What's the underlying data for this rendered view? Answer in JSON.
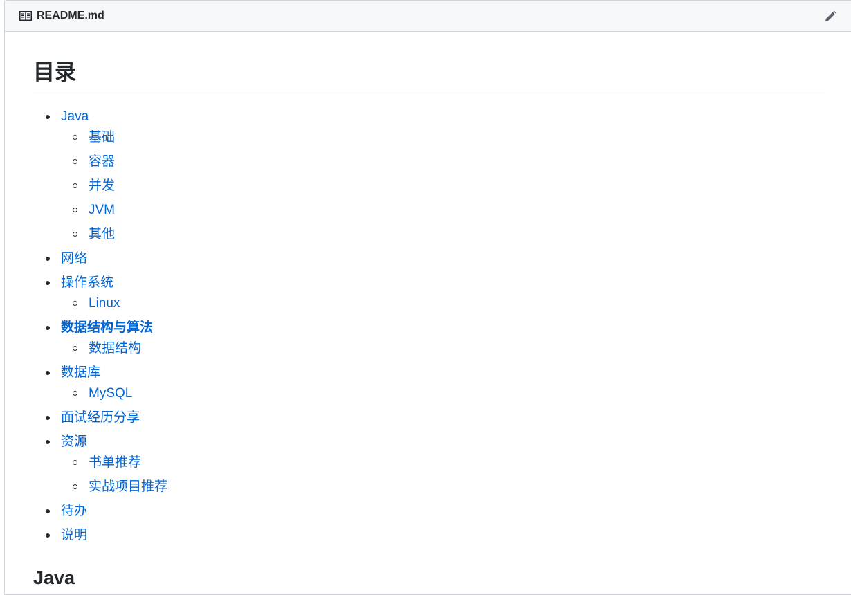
{
  "file": {
    "name": "README.md"
  },
  "icons": {
    "file": "book-icon",
    "edit": "pencil-icon"
  },
  "colors": {
    "link": "#0366d6",
    "text": "#24292e",
    "header_bg": "#f6f8fa"
  },
  "toc": {
    "title": "目录",
    "items": [
      {
        "label": "Java",
        "children": [
          "基础",
          "容器",
          "并发",
          "JVM",
          "其他"
        ]
      },
      {
        "label": "网络",
        "children": []
      },
      {
        "label": "操作系统",
        "children": [
          "Linux"
        ]
      },
      {
        "label": "数据结构与算法",
        "children": [
          "数据结构"
        ],
        "bold": true
      },
      {
        "label": "数据库",
        "children": [
          "MySQL"
        ]
      },
      {
        "label": "面试经历分享",
        "children": []
      },
      {
        "label": "资源",
        "children": [
          "书单推荐",
          "实战项目推荐"
        ]
      },
      {
        "label": "待办",
        "children": []
      },
      {
        "label": "说明",
        "children": []
      }
    ]
  },
  "section_heading": "Java"
}
